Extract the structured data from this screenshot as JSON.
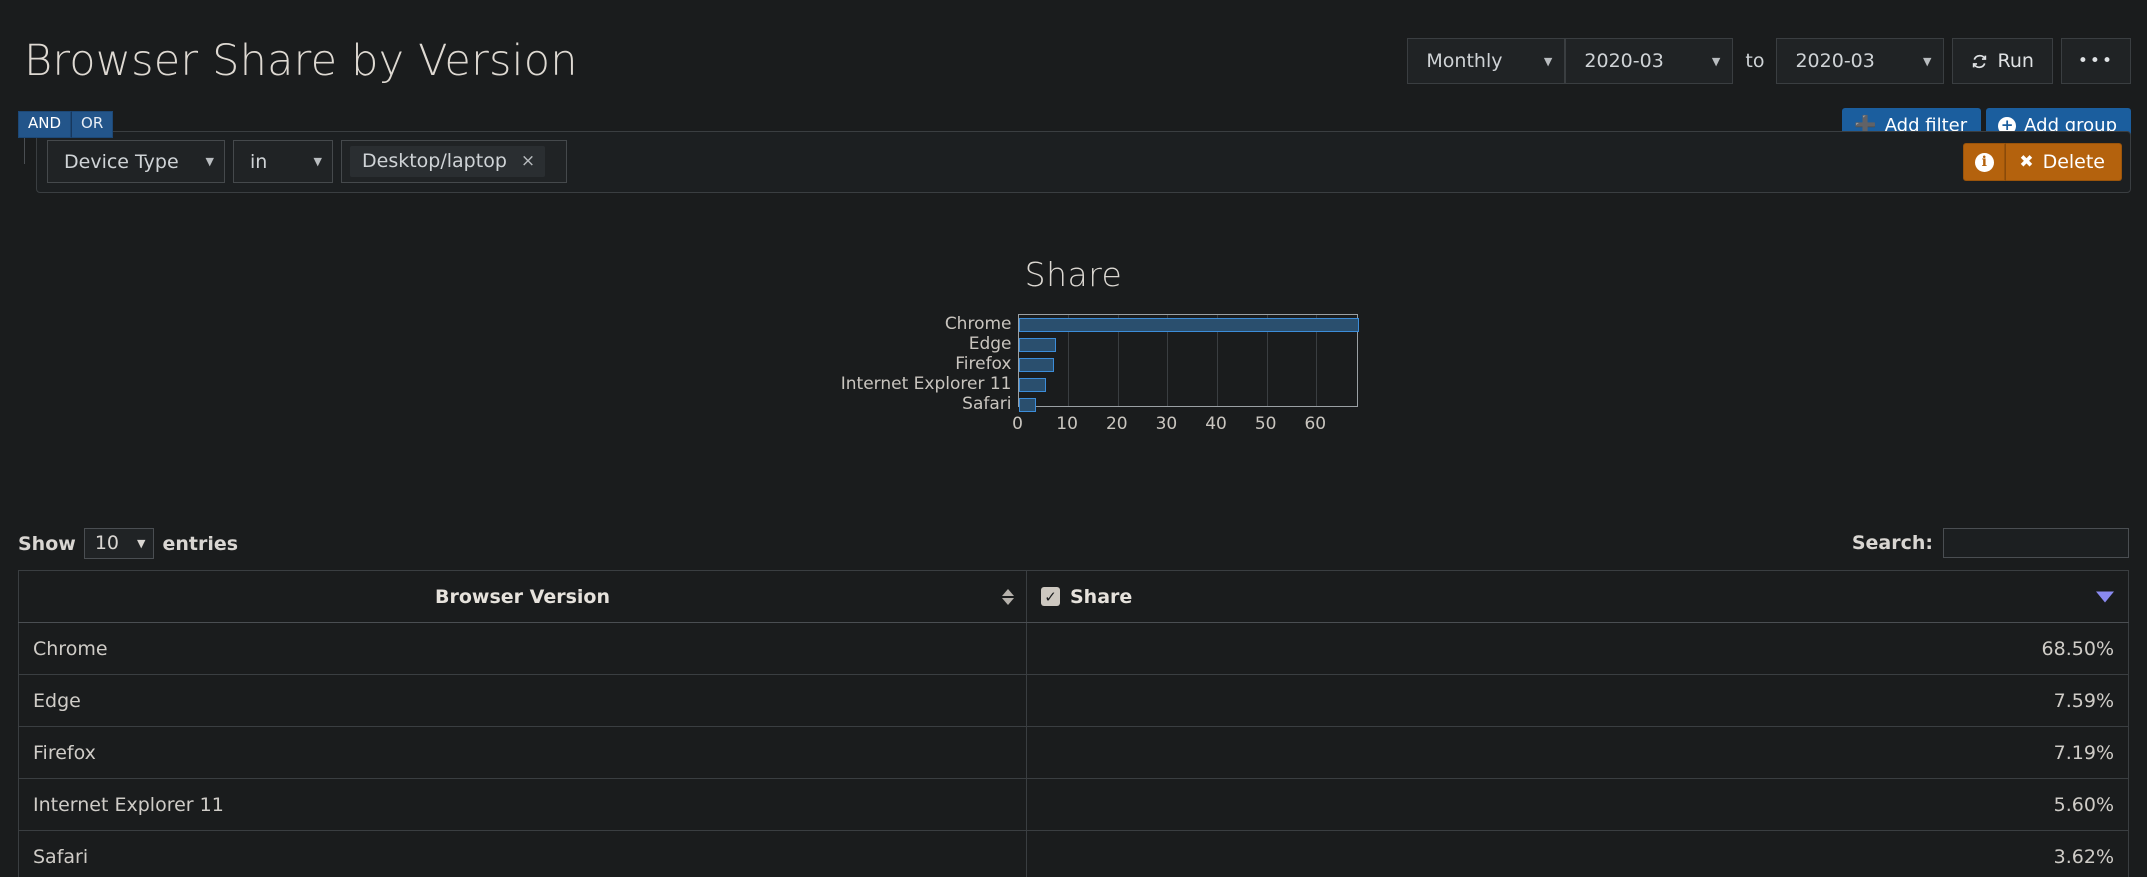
{
  "header": {
    "title": "Browser Share by Version"
  },
  "toolbar": {
    "period": "Monthly",
    "date_from": "2020-03",
    "to_label": "to",
    "date_to": "2020-03",
    "run_label": "Run",
    "run_icon": "refresh-icon",
    "more_label": "•••"
  },
  "filters": {
    "logic": {
      "and": "AND",
      "or": "OR",
      "selected": "AND"
    },
    "add_filter_label": "Add filter",
    "add_group_label": "Add group",
    "add_filter_icon": "plus-icon",
    "add_group_icon": "circle-plus-icon",
    "row": {
      "field": "Device Type",
      "operator": "in",
      "tags": [
        {
          "label": "Desktop/laptop",
          "remove_icon": "×"
        }
      ],
      "info_icon": "i",
      "delete_label": "Delete",
      "delete_icon": "✖"
    },
    "accent_blue": "#1b5e9e",
    "accent_orange": "#b4620d"
  },
  "chart_data": {
    "type": "bar",
    "orientation": "horizontal",
    "title": "Share",
    "xlabel": "",
    "ylabel": "",
    "categories": [
      "Chrome",
      "Edge",
      "Firefox",
      "Internet Explorer 11",
      "Safari"
    ],
    "values": [
      68.5,
      7.59,
      7.19,
      5.6,
      3.62
    ],
    "xticks": [
      0,
      10,
      20,
      30,
      40,
      50,
      60
    ],
    "xlim": [
      0,
      68.5
    ],
    "grid": true,
    "legend": "none",
    "bar_fill": "#2a4f6e",
    "bar_border": "#3c8dd9"
  },
  "table_controls": {
    "show_label": "Show",
    "entries_value": "10",
    "entries_label": "entries",
    "search_label": "Search:",
    "search_value": "",
    "search_placeholder": ""
  },
  "table": {
    "columns": [
      {
        "label": "Browser Version",
        "sort_icon": "sort-updown-icon"
      },
      {
        "label": "Share",
        "checkbox": true,
        "sort_icon": "sort-desc-icon"
      }
    ],
    "rows": [
      {
        "name": "Chrome",
        "share": "68.50%"
      },
      {
        "name": "Edge",
        "share": "7.59%"
      },
      {
        "name": "Firefox",
        "share": "7.19%"
      },
      {
        "name": "Internet Explorer 11",
        "share": "5.60%"
      },
      {
        "name": "Safari",
        "share": "3.62%"
      }
    ]
  }
}
